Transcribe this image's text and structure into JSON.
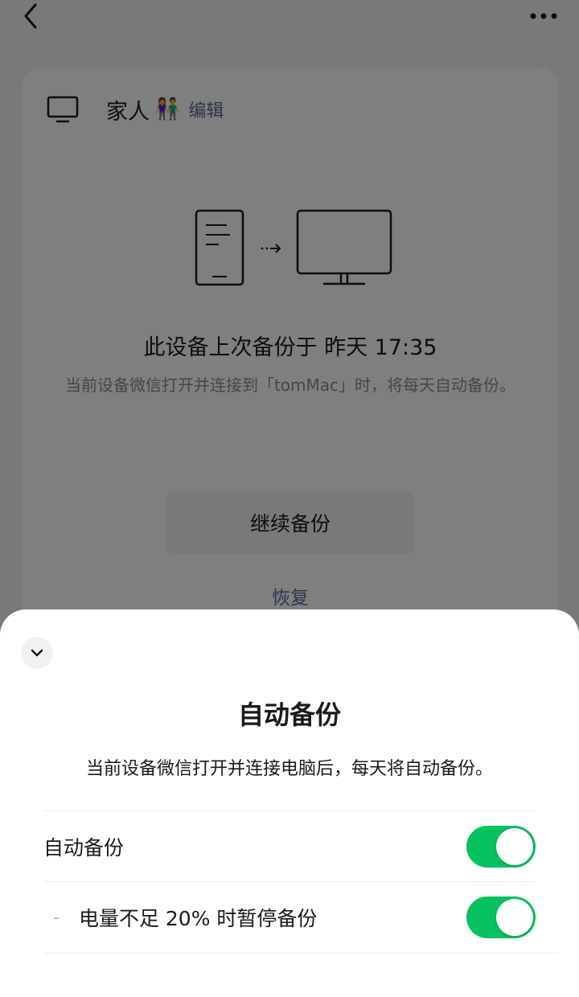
{
  "header": {
    "back_icon": "chevron-left-icon",
    "more_icon": "more-dots-icon"
  },
  "device": {
    "icon": "monitor-icon",
    "name": "家人",
    "emoji": "👫",
    "edit_label": "编辑"
  },
  "illustration": {
    "phone_icon": "phone-icon",
    "arrow_icon": "arrow-right-icon",
    "computer_icon": "computer-icon"
  },
  "status": {
    "last_backup": "此设备上次备份于 昨天 17:35",
    "description": "当前设备微信打开并连接到「tomMac」时，将每天自动备份。"
  },
  "actions": {
    "continue_label": "继续备份",
    "restore_label": "恢复"
  },
  "sheet": {
    "collapse_icon": "chevron-down-icon",
    "title": "自动备份",
    "description": "当前设备微信打开并连接电脑后，每天将自动备份。",
    "settings": [
      {
        "label": "自动备份",
        "enabled": true
      },
      {
        "prefix": "-",
        "label": "电量不足 20% 时暂停备份",
        "enabled": true
      }
    ]
  },
  "colors": {
    "accent_green": "#07c160",
    "link_blue": "#576b95"
  }
}
